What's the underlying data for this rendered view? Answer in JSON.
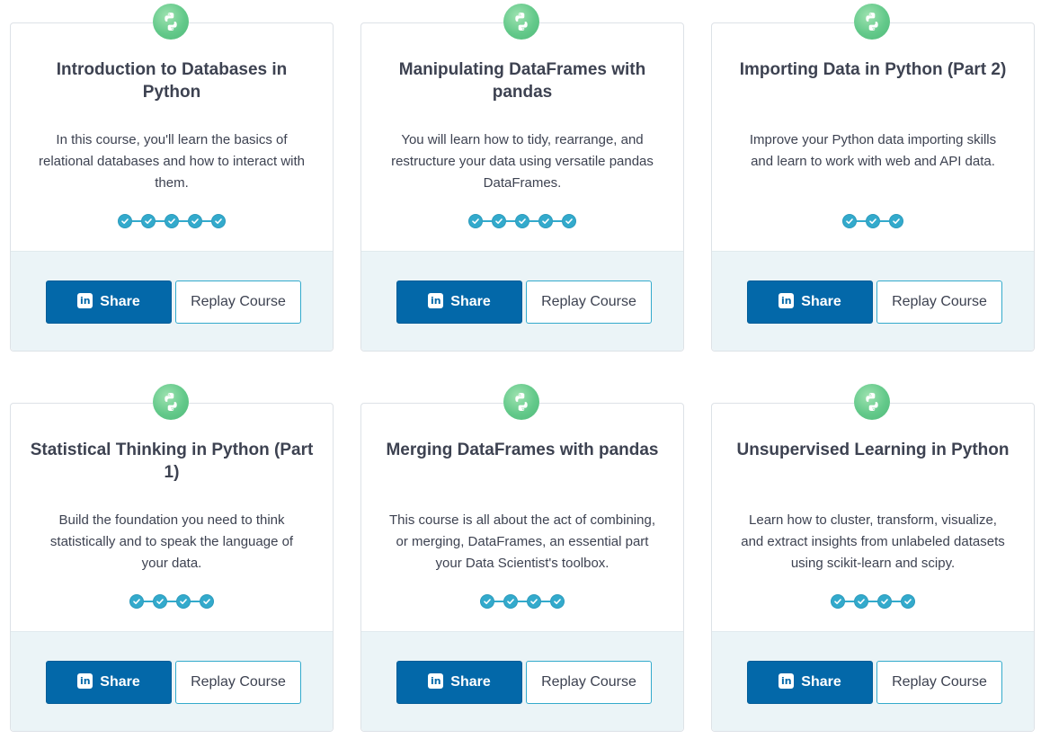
{
  "courses": [
    {
      "title": "Introduction to Databases in Python",
      "description": "In this course, you'll learn the basics of relational databases and how to interact with them.",
      "chapters_completed": 5,
      "icon": "python-icon",
      "share_label": "Share",
      "replay_label": "Replay Course"
    },
    {
      "title": "Manipulating DataFrames with pandas",
      "description": "You will learn how to tidy, rearrange, and restructure your data using versatile pandas DataFrames.",
      "chapters_completed": 5,
      "icon": "python-icon",
      "share_label": "Share",
      "replay_label": "Replay Course"
    },
    {
      "title": "Importing Data in Python (Part 2)",
      "description": "Improve your Python data importing skills and learn to work with web and API data.",
      "chapters_completed": 3,
      "icon": "python-icon",
      "share_label": "Share",
      "replay_label": "Replay Course"
    },
    {
      "title": "Statistical Thinking in Python (Part 1)",
      "description": "Build the foundation you need to think statistically and to speak the language of your data.",
      "chapters_completed": 4,
      "icon": "python-icon",
      "share_label": "Share",
      "replay_label": "Replay Course"
    },
    {
      "title": "Merging DataFrames with pandas",
      "description": "This course is all about the act of combining, or merging, DataFrames, an essential part your Data Scientist's toolbox.",
      "chapters_completed": 4,
      "icon": "python-icon",
      "share_label": "Share",
      "replay_label": "Replay Course"
    },
    {
      "title": "Unsupervised Learning in Python",
      "description": "Learn how to cluster, transform, visualize, and extract insights from unlabeled datasets using scikit-learn and scipy.",
      "chapters_completed": 4,
      "icon": "python-icon",
      "share_label": "Share",
      "replay_label": "Replay Course"
    }
  ],
  "linkedin_glyph": "in",
  "colors": {
    "share_button": "#0368a9",
    "progress_step": "#33aacc",
    "card_footer": "#ebf4f7",
    "icon_green": "#63c98a"
  }
}
